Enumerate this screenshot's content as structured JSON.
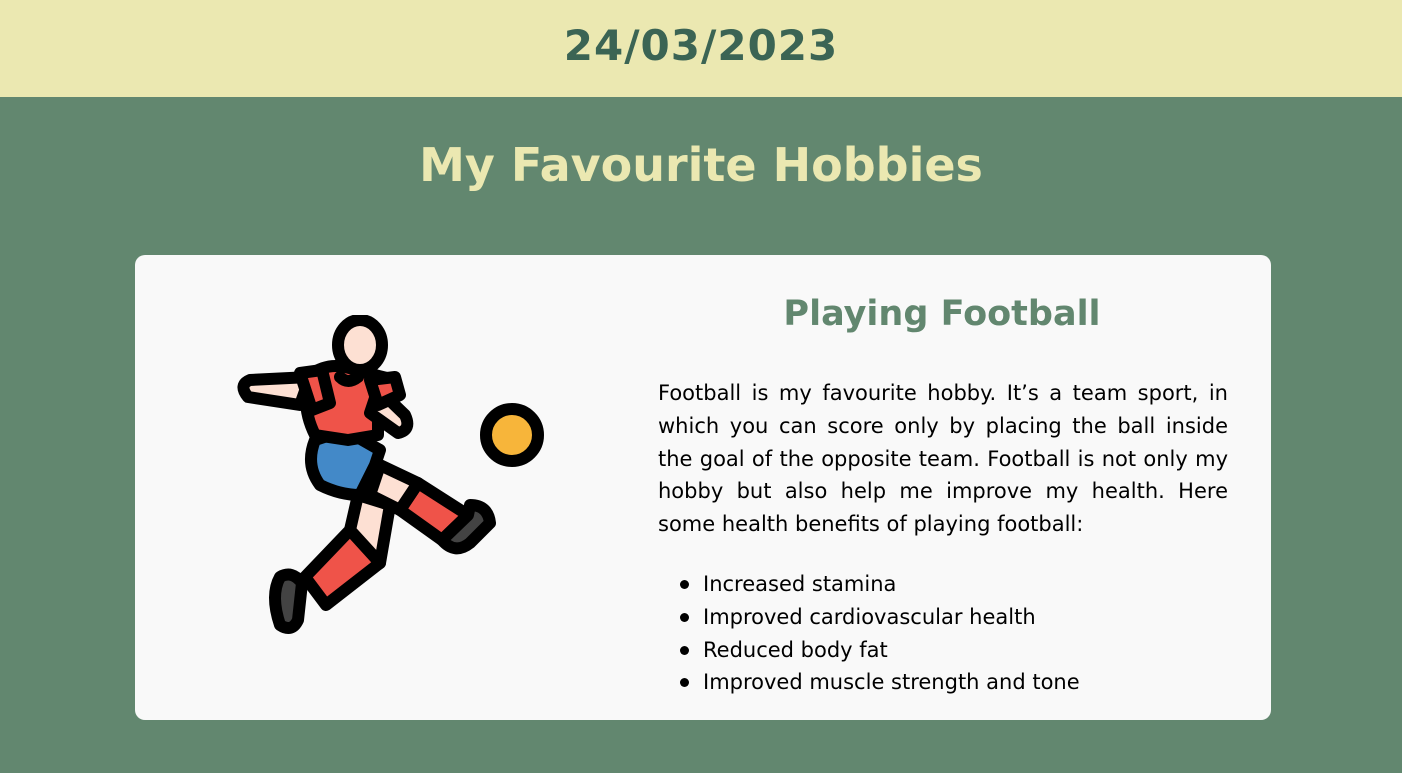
{
  "header": {
    "date": "24/03/2023"
  },
  "page": {
    "title": "My Favourite Hobbies"
  },
  "card": {
    "image_icon": "football-player-kicking-ball-icon",
    "title": "Playing Football",
    "description": "Football is my favourite hobby. It’s a team sport, in which you can score only by placing the ball inside the goal of the opposite team. Football is not only my hobby but also help me improve my health. Here some health benefits of playing football:",
    "benefits": [
      "Increased stamina",
      "Improved cardiovascular health",
      "Reduced body fat",
      "Improved muscle strength and tone"
    ]
  },
  "colors": {
    "background": "#62876f",
    "banner": "#ebe8b1",
    "date_text": "#3b6454",
    "card": "#f9f9f9",
    "shirt": "#ef5349",
    "shorts": "#4389c8",
    "skin": "#fde0d3",
    "ball": "#f7b53a",
    "shoe": "#434343"
  }
}
